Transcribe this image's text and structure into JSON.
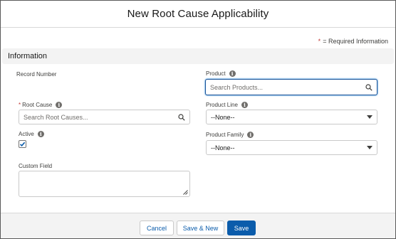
{
  "modal": {
    "title": "New Root Cause Applicability",
    "required_note": "= Required Information",
    "required_star": "*"
  },
  "section": {
    "title": "Information"
  },
  "fields": {
    "record_number": {
      "label": "Record Number"
    },
    "root_cause": {
      "label": "Root Cause",
      "required_star": "*",
      "placeholder": "Search Root Causes..."
    },
    "active": {
      "label": "Active",
      "checked": true
    },
    "custom_field": {
      "label": "Custom Field",
      "value": ""
    },
    "product": {
      "label": "Product",
      "placeholder": "Search Products..."
    },
    "product_line": {
      "label": "Product Line",
      "value": "--None--"
    },
    "product_family": {
      "label": "Product Family",
      "value": "--None--"
    }
  },
  "footer": {
    "cancel_label": "Cancel",
    "save_new_label": "Save & New",
    "save_label": "Save"
  },
  "icons": {
    "info": "info-icon",
    "search": "search-icon",
    "dropdown": "chevron-down-icon",
    "check": "checkmark-icon"
  },
  "colors": {
    "brand": "#0b5cab",
    "required": "#c23934",
    "section_bg": "#f3f3f3",
    "focus_border": "#1b5297"
  }
}
